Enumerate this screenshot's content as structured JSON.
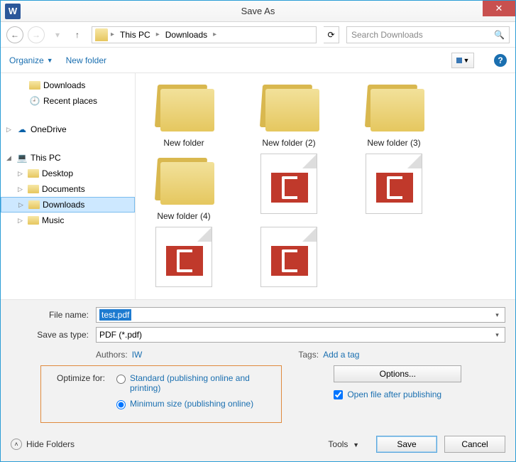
{
  "window": {
    "title": "Save As",
    "app_letter": "W",
    "close": "✕"
  },
  "nav": {
    "breadcrumb": [
      "This PC",
      "Downloads"
    ],
    "search_placeholder": "Search Downloads"
  },
  "toolbar": {
    "organize": "Organize",
    "new_folder": "New folder",
    "help": "?"
  },
  "tree": {
    "quick": [
      "Downloads",
      "Recent places"
    ],
    "onedrive": "OneDrive",
    "thispc": "This PC",
    "pc_children": [
      "Desktop",
      "Documents",
      "Downloads",
      "Music"
    ],
    "selected": "Downloads"
  },
  "files": {
    "folders": [
      "New folder",
      "New folder (2)",
      "New folder (3)",
      "New folder (4)"
    ],
    "docs_count": 4
  },
  "form": {
    "filename_label": "File name:",
    "filename_value": "test.pdf",
    "type_label": "Save as type:",
    "type_value": "PDF (*.pdf)",
    "authors_label": "Authors:",
    "authors_value": "IW",
    "tags_label": "Tags:",
    "tags_value": "Add a tag",
    "optimize_label": "Optimize for:",
    "opt_standard": "Standard (publishing online and printing)",
    "opt_minimum": "Minimum size (publishing online)",
    "options_btn": "Options...",
    "open_after": "Open file after publishing",
    "hide_folders": "Hide Folders",
    "tools": "Tools",
    "save": "Save",
    "cancel": "Cancel"
  }
}
